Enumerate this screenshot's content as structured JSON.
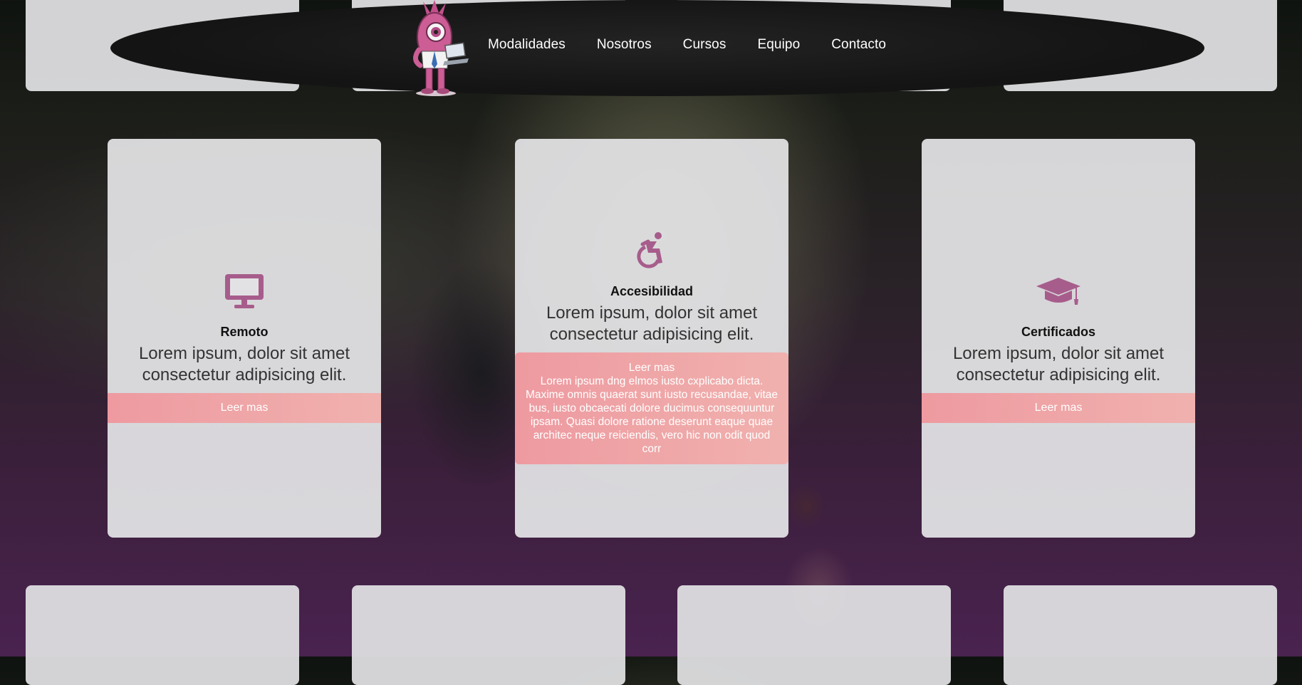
{
  "colors": {
    "accent_icon": "#a75d8c",
    "button_gradient_start": "#ee9aa0",
    "button_gradient_end": "#f0b1ae",
    "header_bg": "#141414",
    "card_bg": "#e2e2e4"
  },
  "nav": {
    "items": [
      {
        "label": "Modalidades"
      },
      {
        "label": "Nosotros"
      },
      {
        "label": "Cursos"
      },
      {
        "label": "Equipo"
      },
      {
        "label": "Contacto"
      }
    ]
  },
  "cards": [
    {
      "icon": "monitor-icon",
      "title": "Remoto",
      "desc_line1": "Lorem ipsum, dolor sit amet",
      "desc_line2": "consectetur adipisicing elit.",
      "button": "Leer mas"
    },
    {
      "icon": "wheelchair-icon",
      "title": "Accesibilidad",
      "desc_line1": "Lorem ipsum, dolor sit amet",
      "desc_line2": "consectetur adipisicing elit.",
      "button": "Leer mas",
      "expanded_text": "Lorem ipsum dng elmos iusto cxplicabo dicta. Maxime omnis quaerat sunt iusto recusandae, vitae bus, iusto obcaecati dolore ducimus consequuntur ipsam. Quasi dolore ratione deserunt eaque quae architec neque reiciendis, vero hic non odit quod corr"
    },
    {
      "icon": "graduation-cap-icon",
      "title": "Certificados",
      "desc_line1": "Lorem ipsum, dolor sit amet",
      "desc_line2": "consectetur adipisicing elit.",
      "button": "Leer mas"
    }
  ]
}
